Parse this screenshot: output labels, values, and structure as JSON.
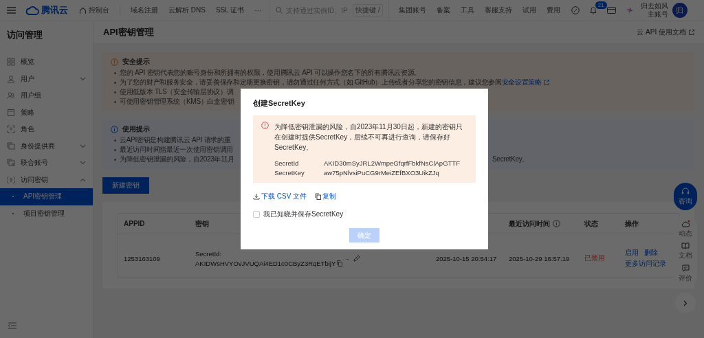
{
  "topbar": {
    "logo": "腾讯云",
    "nav": [
      {
        "label": "控制台",
        "kind": "home"
      },
      {
        "label": "域名注册",
        "kind": "plain"
      },
      {
        "label": "云解析 DNS",
        "kind": "plain"
      },
      {
        "label": "SSL 证书",
        "kind": "plain"
      },
      {
        "label": "···",
        "kind": "plain"
      }
    ],
    "search": {
      "placeholder": "支持通过实例ID、IP、",
      "shortcut": "快捷键 /"
    },
    "links": [
      "集团账号",
      "备案",
      "工具",
      "客服支持",
      "试用",
      "费用"
    ],
    "notifications": "21",
    "user": {
      "name": "归去如风",
      "role": "主账号",
      "avatar": "归"
    }
  },
  "sidebar": {
    "title": "访问管理",
    "items": [
      {
        "label": "概览"
      },
      {
        "label": "用户",
        "expanded": false
      },
      {
        "label": "用户组"
      },
      {
        "label": "策略"
      },
      {
        "label": "角色"
      },
      {
        "label": "身份提供商",
        "expanded": false
      },
      {
        "label": "联合账号",
        "expanded": false
      },
      {
        "label": "访问密钥",
        "expanded": true,
        "children": [
          {
            "label": "API密钥管理",
            "selected": true
          },
          {
            "label": "项目密钥管理",
            "selected": false
          }
        ]
      }
    ]
  },
  "page": {
    "title": "API密钥管理",
    "doc_link": "云 API 使用文档"
  },
  "security_tips": {
    "title": "安全提示",
    "lines": [
      {
        "text": "您的 API 密钥代表您的账号身份和所拥有的权限，使用腾讯云 API 可以操作您名下的所有腾讯云资源。"
      },
      {
        "text": "为了您的财产和服务安全，请妥善保存和定期更换密钥，请勿通过任何方式（如 GitHub）上传或者分享您的密钥信息，建议您参阅",
        "link": "安全设置策略"
      },
      {
        "text": "使用低版本 TLS（安全传输层协议）调"
      },
      {
        "text": "可使用密钥管理系统（KMS）白盒密钥"
      }
    ]
  },
  "usage_tips": {
    "title": "使用提示",
    "lines": [
      {
        "text": "云API密钥是构建腾讯云 API 请求的重"
      },
      {
        "text": "最近访问时间指最近一次使用密钥调用"
      },
      {
        "text": "为降低密钥泄漏的风险，自2023年11月",
        "tail": "SecretKey。"
      }
    ]
  },
  "create_button": "新建密钥",
  "table": {
    "columns": [
      "APPID",
      "密钥",
      "最近访问时间",
      "状态",
      "操作"
    ],
    "rows": [
      {
        "appid": "1253163109",
        "key_label": "SecretId:",
        "key_value": "AKIDWsHVYOvJVUQAi4ED1c0CByZ3RqETbijY",
        "remark": "-",
        "created": "2025-10-15 20:54:17",
        "last_access": "2025-10-29 16:57:19",
        "status": "已禁用",
        "actions": [
          "启用",
          "删除",
          "更多访问记录"
        ]
      }
    ]
  },
  "float_panel": {
    "consult": "咨询",
    "items": [
      "动态",
      "文档",
      "评价"
    ]
  },
  "modal": {
    "title": "创建SecretKey",
    "notice": "为降低密钥泄漏的风险，自2023年11月30日起，新建的密钥只在创建时提供SecretKey，后续不可再进行查询，请保存好SecretKey。",
    "fields": [
      {
        "label": "SecretId",
        "value": "AKID30mSyJRL2WmpeGfqrfFbkfNsClApGTTF"
      },
      {
        "label": "SecretKey",
        "value": "aw75pNlvsiPuCG9rMeiZEfBXO3UikZJq"
      }
    ],
    "actions": [
      {
        "label": "下载 CSV 文件",
        "kind": "download"
      },
      {
        "label": "复制",
        "kind": "copy"
      }
    ],
    "acknowledge": {
      "label": "我已知晓并保存SecretKey",
      "checked": false
    },
    "confirm": {
      "label": "确定",
      "disabled": true
    }
  }
}
